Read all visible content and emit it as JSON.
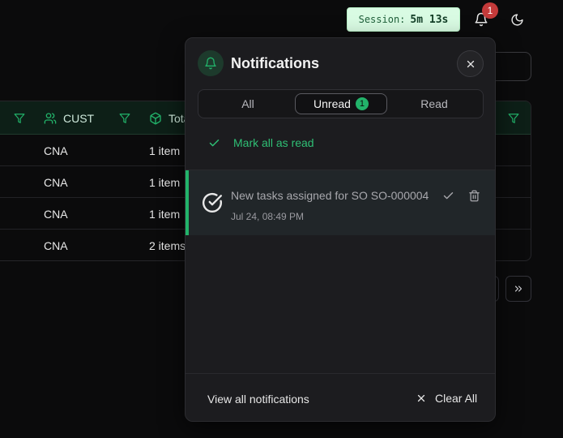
{
  "topbar": {
    "session_label": "Session:",
    "session_value": "5m 13s",
    "notification_count": "1"
  },
  "table": {
    "columns": [
      "CUST",
      "Tota"
    ],
    "rows": [
      {
        "cust": "CNA",
        "total": "1 item"
      },
      {
        "cust": "CNA",
        "total": "1 item"
      },
      {
        "cust": "CNA",
        "total": "1 item"
      },
      {
        "cust": "CNA",
        "total": "2 items"
      }
    ]
  },
  "panel": {
    "title": "Notifications",
    "tabs": [
      {
        "label": "All",
        "active": false
      },
      {
        "label": "Unread",
        "active": true,
        "badge": "1"
      },
      {
        "label": "Read",
        "active": false
      }
    ],
    "mark_all_label": "Mark all as read",
    "notifications": [
      {
        "text": "New tasks assigned for SO SO-000004",
        "time": "Jul 24, 08:49 PM",
        "unread": true
      }
    ],
    "view_all_label": "View all notifications",
    "clear_all_label": "Clear All"
  },
  "colors": {
    "accent": "#22b36a",
    "badge_red": "#c43a3a",
    "session_bg": "#d9fbe3"
  }
}
